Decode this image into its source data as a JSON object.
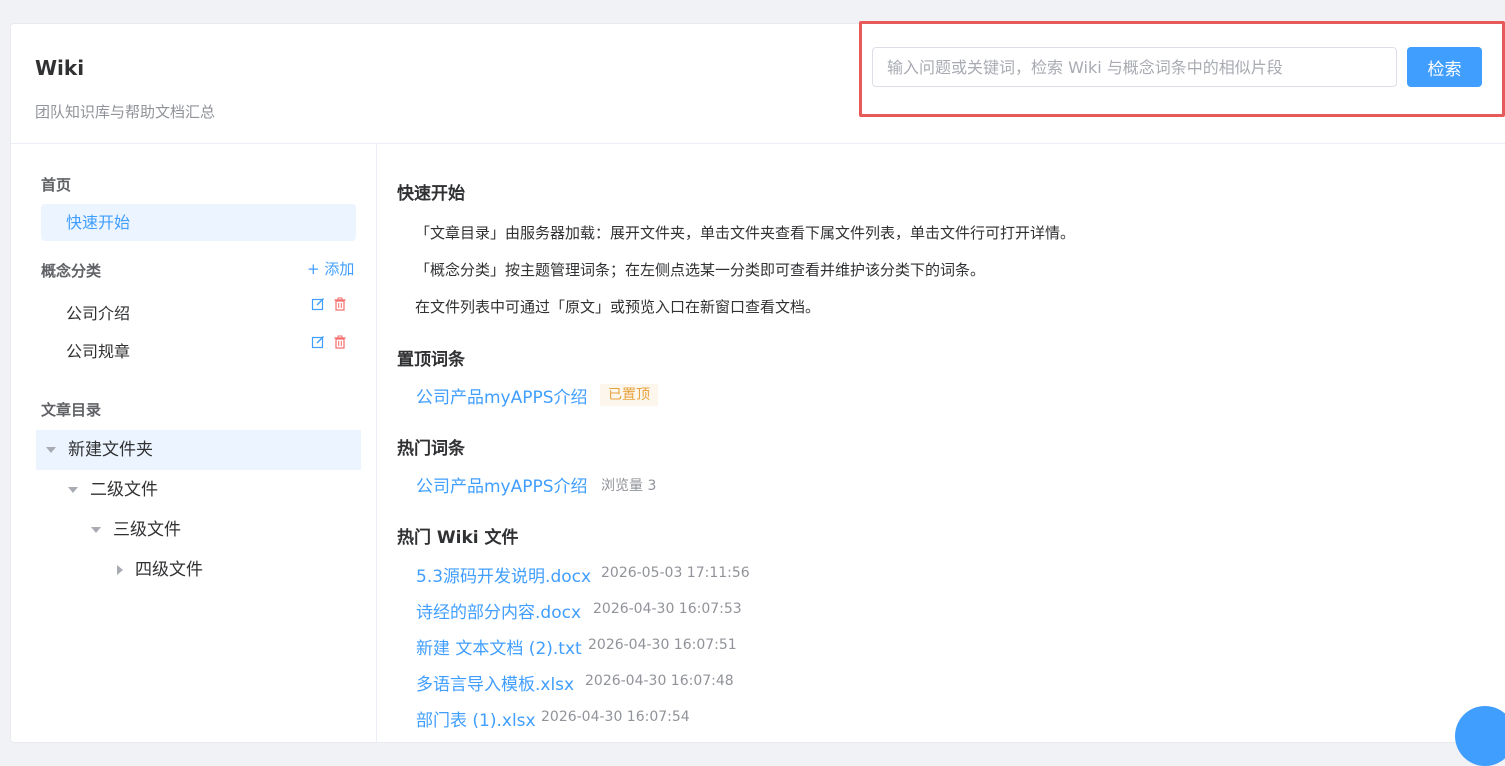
{
  "header": {
    "title": "Wiki",
    "subtitle": "团队知识库与帮助文档汇总",
    "search_placeholder": "输入问题或关键词，检索 Wiki 与概念词条中的相似片段",
    "search_button": "检索"
  },
  "sidebar": {
    "home_label": "首页",
    "quick_start": "快速开始",
    "concept_label": "概念分类",
    "add_label": "+ 添加",
    "concept_items": [
      "公司介绍",
      "公司规章"
    ],
    "catalog_label": "文章目录",
    "tree": [
      "新建文件夹",
      "二级文件",
      "三级文件",
      "四级文件"
    ]
  },
  "main": {
    "quick_start_title": "快速开始",
    "guide_lines": [
      "「文章目录」由服务器加载：展开文件夹，单击文件夹查看下属文件列表，单击文件行可打开详情。",
      "「概念分类」按主题管理词条；在左侧点选某一分类即可查看并维护该分类下的词条。",
      "在文件列表中可通过「原文」或预览入口在新窗口查看文档。"
    ],
    "pinned_title": "置顶词条",
    "pinned_term": "公司产品myAPPS介绍",
    "pinned_badge": "已置顶",
    "hot_terms_title": "热门词条",
    "hot_term": "公司产品myAPPS介绍",
    "hot_term_views": "浏览量 3",
    "hot_files_title": "热门 Wiki 文件",
    "files": [
      {
        "name": "5.3源码开发说明.docx",
        "time": "2026-05-03 17:11:56"
      },
      {
        "name": "诗经的部分内容.docx",
        "time": "2026-04-30 16:07:53"
      },
      {
        "name": "新建 文本文档 (2).txt",
        "time": "2026-04-30 16:07:51"
      },
      {
        "name": "多语言导入模板.xlsx",
        "time": "2026-04-30 16:07:48"
      },
      {
        "name": "部门表 (1).xlsx",
        "time": "2026-04-30 16:07:54"
      }
    ]
  },
  "colors": {
    "accent": "#409eff",
    "highlight_border": "#e85a5a",
    "badge_text": "#e6a23c",
    "delete": "#f56c6c"
  }
}
